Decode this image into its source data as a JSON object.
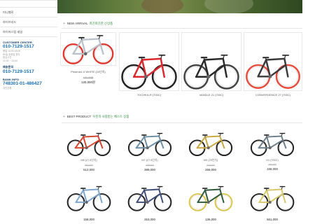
{
  "sidebar": {
    "menu": [
      "",
      "미니벨로",
      "하이브리드",
      "하이커스텀 세일"
    ],
    "customer_center": {
      "caption": "CUSTOMER CENTER",
      "phone": "010-7129-1517",
      "lines": [
        "평일 10:00-18:00",
        "토/일,공휴일 휴무",
        "점심시간",
        "12:00 ~ 13:00"
      ]
    },
    "return": {
      "caption": "배송문의",
      "phone": "010-7129-1517"
    },
    "bank": {
      "caption": "BANK INFO",
      "account": "748301-01-486427",
      "holder": "국민은행"
    }
  },
  "new_arrival": {
    "title_en": "NEW ARRIVAL",
    "title_ko": "따끈따끈한 신상품",
    "items": [
      {
        "name": "Phoenix1.0 WHITE (24인치)",
        "old_price": "139,000원",
        "price": "120,000원",
        "color": "#b9c2cc",
        "accent": "#e0342c"
      },
      {
        "name": "TOCHKA-R (700C)",
        "old_price": "",
        "price": "",
        "color": "#d9282e",
        "accent": "#222222"
      },
      {
        "name": "VANDLE 21 (700C)",
        "old_price": "",
        "price": "",
        "color": "#2a2a2a",
        "accent": "#444444"
      },
      {
        "name": "CONVERGENCE 27 (700C)",
        "old_price": "",
        "price": "",
        "color": "#3a3a3a",
        "accent": "#e74c3c"
      }
    ]
  },
  "best_product": {
    "title_en": "BEST PRODUCT",
    "title_ko": "꾸준히 사랑받는 베스트 상품",
    "items": [
      {
        "name": "M8 (27.5인치)",
        "old_price": "693,000",
        "price": "512,000",
        "color": "#d6452e",
        "accent": "#222222"
      },
      {
        "name": "M7 (27.5인치)",
        "old_price": "408,000",
        "price": "389,000",
        "color": "#6b8fa8",
        "accent": "#222222"
      },
      {
        "name": "M5 (29인치)",
        "old_price": "376,000",
        "price": "266,000",
        "color": "#c7a742",
        "accent": "#1e1e1e"
      },
      {
        "name": "H1 (700C)",
        "old_price": "197,000",
        "price": "158,000",
        "color": "#6d7d8a",
        "accent": "#222222"
      },
      {
        "name": "",
        "old_price": "",
        "price": "158,000",
        "color": "#7fa6cc",
        "accent": "#222222"
      },
      {
        "name": "",
        "old_price": "",
        "price": "263,000",
        "color": "#3f4f7a",
        "accent": "#222222"
      },
      {
        "name": "",
        "old_price": "",
        "price": "136,000",
        "color": "#2f5a3a",
        "accent": "#d9c44a"
      },
      {
        "name": "",
        "old_price": "",
        "price": "561,000",
        "color": "#d8c86a",
        "accent": "#222222"
      }
    ]
  }
}
